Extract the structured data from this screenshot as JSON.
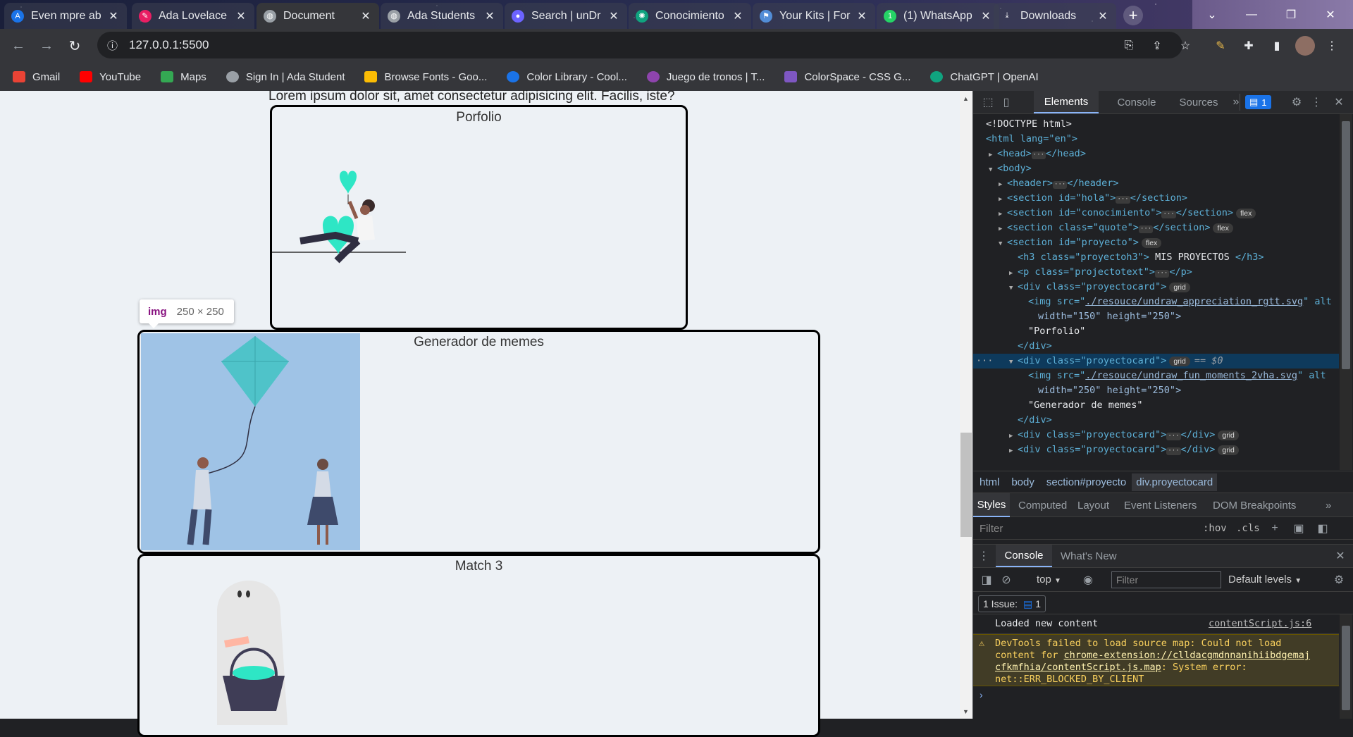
{
  "browser": {
    "tabs": [
      {
        "title": "Even mpre ab",
        "icon": "ada-icon",
        "color": "#1a73e8",
        "active": false
      },
      {
        "title": "Ada Lovelace",
        "icon": "pencil-icon",
        "color": "#e91e63",
        "active": false
      },
      {
        "title": "Document",
        "icon": "globe-icon",
        "color": "#9aa0a6",
        "active": true
      },
      {
        "title": "Ada Students",
        "icon": "globe-icon",
        "color": "#9aa0a6",
        "active": false
      },
      {
        "title": "Search | unDr",
        "icon": "undraw-icon",
        "color": "#6c63ff",
        "active": false
      },
      {
        "title": "Conocimiento",
        "icon": "chatgpt-icon",
        "color": "#10a37f",
        "active": false
      },
      {
        "title": "Your Kits | For",
        "icon": "flag-icon",
        "color": "#528dd7",
        "active": false
      },
      {
        "title": "(1) WhatsApp",
        "icon": "whatsapp-icon",
        "color": "#25d366",
        "active": false
      },
      {
        "title": "Downloads",
        "icon": "download-icon",
        "color": "#9aa0a6",
        "active": false
      }
    ],
    "url": "127.0.0.1:5500",
    "bookmarks": [
      {
        "label": "Gmail",
        "color": "#ea4335"
      },
      {
        "label": "YouTube",
        "color": "#ff0000"
      },
      {
        "label": "Maps",
        "color": "#34a853"
      },
      {
        "label": "Sign In | Ada Student",
        "color": "#9aa0a6"
      },
      {
        "label": "Browse Fonts - Goo...",
        "color": "#fbbc04"
      },
      {
        "label": "Color Library - Cool...",
        "color": "#1a73e8"
      },
      {
        "label": "Juego de tronos | T...",
        "color": "#8e44ad"
      },
      {
        "label": "ColorSpace - CSS G...",
        "color": "#7e57c2"
      },
      {
        "label": "ChatGPT | OpenAI",
        "color": "#10a37f"
      }
    ]
  },
  "page": {
    "intro": "Lorem ipsum dolor sit, amet consectetur adipisicing elit. Facilis, iste?",
    "cards": [
      {
        "title": "Porfolio"
      },
      {
        "title": "Generador de memes"
      },
      {
        "title": "Match 3"
      }
    ],
    "tooltip": {
      "tag": "img",
      "size": "250 × 250"
    },
    "colors": {
      "accent_teal": "#2ee6c5",
      "kite_bg": "#9fc3e6",
      "kite": "#4fc3c9"
    }
  },
  "devtools": {
    "tabs": [
      "Elements",
      "Console",
      "Sources"
    ],
    "issues_badge": "1",
    "dom": {
      "l0": "<!DOCTYPE html>",
      "l1_tag": "<html lang=\"en\">",
      "l2": "<head>",
      "l2b": "</head>",
      "l3": "<body>",
      "l4": "<header>",
      "l4b": "</header>",
      "l5a": "<section id=\"hola\">",
      "l5b": "</section>",
      "l6a": "<section id=\"conocimiento\">",
      "l6b": "</section>",
      "l7a": "<section class=\"quote\">",
      "l7b": "</section>",
      "l8a": "<section id=\"proyecto\">",
      "l9a": "<h3 class=\"proyectoh3\">",
      "l9t": " MIS PROYECTOS ",
      "l9b": "</h3>",
      "l10a": "<p class=\"projectotext\">",
      "l10b": "</p>",
      "l11a": "<div class=\"proyectocard\">",
      "l12a": "<img src=\"",
      "l12l": "./resouce/undraw_appreciation_rgtt.svg",
      "l12b": "\" alt",
      "l13": "width=\"150\" height=\"250\">",
      "l14": "\"Porfolio\"",
      "l15": "</div>",
      "l16a": "<div class=\"proyectocard\">",
      "l16s": "== $0",
      "l17a": "<img src=\"",
      "l17l": "./resouce/undraw_fun_moments_2vha.svg",
      "l17b": "\" alt",
      "l18": "width=\"250\" height=\"250\">",
      "l19": "\"Generador de memes\"",
      "l20": "</div>",
      "l21a": "<div class=\"proyectocard\">",
      "l21b": "</div>",
      "badge_flex": "flex",
      "badge_grid": "grid"
    },
    "breadcrumbs": [
      "html",
      "body",
      "section#proyecto",
      "div.proyectocard"
    ],
    "styles_tabs": [
      "Styles",
      "Computed",
      "Layout",
      "Event Listeners",
      "DOM Breakpoints"
    ],
    "filter_placeholder": "Filter",
    "hov": ":hov",
    "cls": ".cls",
    "drawer_tabs": [
      "Console",
      "What's New"
    ],
    "console": {
      "context": "top",
      "filter_placeholder": "Filter",
      "levels": "Default levels",
      "issues": "1 Issue:",
      "issues_count": "1",
      "msg1": "Loaded new content",
      "msg1_src": "contentScript.js:6",
      "warn_a": "DevTools failed to load source map: Could not load",
      "warn_b": "content for ",
      "warn_link1": "chrome-extension://clldacgmdnnanihiibdgemaj",
      "warn_link2": "cfkmfhia/contentScript.js.map",
      "warn_c": ": System error:",
      "warn_d": "net::ERR_BLOCKED_BY_CLIENT",
      "prompt": "›"
    }
  }
}
